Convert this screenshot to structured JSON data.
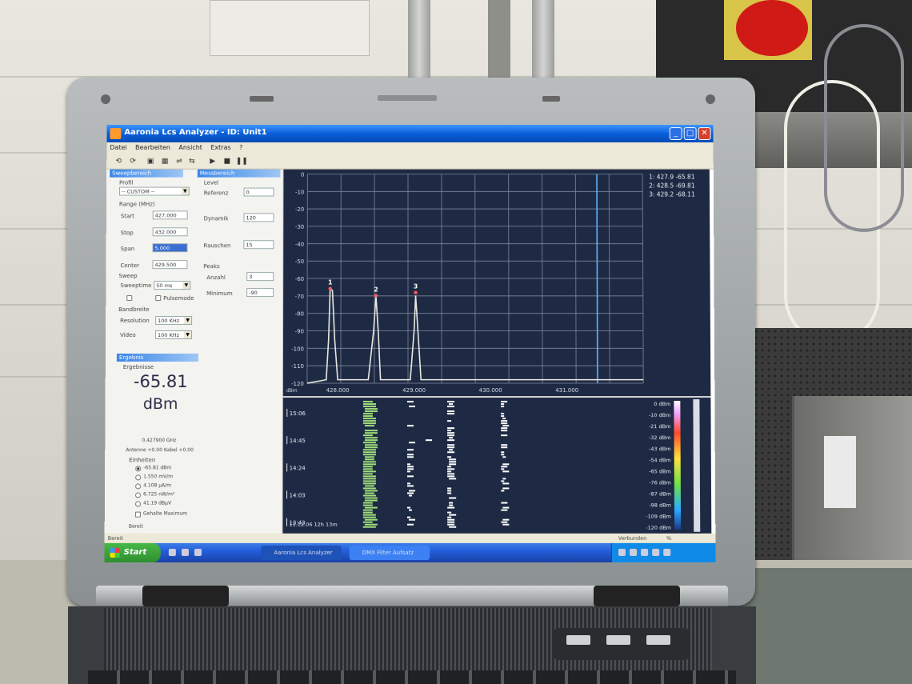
{
  "window": {
    "title": "Aaronia Lcs Analyzer - ID: Unit1",
    "controls": [
      "_",
      "□",
      "✕"
    ]
  },
  "menu": [
    "Datei",
    "Bearbeiten",
    "Ansicht",
    "Extras",
    "?"
  ],
  "toolbar": [
    "⟲",
    "⟳",
    "▣",
    "▦",
    "⇌",
    "⇆",
    "▶",
    "■",
    "❚❚"
  ],
  "sweep_panel": {
    "header": "Sweepbereich",
    "profil_label": "Profil",
    "profil_value": "-- CUSTOM --",
    "range_label": "Range (MHz)",
    "start_label": "Start",
    "start_value": "427.000",
    "stop_label": "Stop",
    "stop_value": "432.000",
    "span_label": "Span",
    "span_value": "5.000",
    "center_label": "Center",
    "center_value": "429.500",
    "sweep_label": "Sweep",
    "sweeptime_label": "Sweeptime",
    "sweeptime_value": "50 ms",
    "pulsemode_label": "Pulsemode",
    "bandwidth_label": "Bandbreite",
    "resolution_label": "Resolution",
    "resolution_value": "100 KHz",
    "video_label": "Video",
    "video_value": "100 KHz"
  },
  "level_panel": {
    "header": "Messbereich",
    "level_label": "Level",
    "referenz_label": "Referenz",
    "referenz_value": "0",
    "dynamik_label": "Dynamik",
    "dynamik_value": "120",
    "rauschen_label": "Rauschen",
    "rauschen_value": "15",
    "peaks_label": "Peaks",
    "anzahl_label": "Anzahl",
    "anzahl_value": "3",
    "minimum_label": "Minimum",
    "minimum_value": "-90"
  },
  "result_panel": {
    "header": "Ergebnis",
    "sub_label": "Ergebnisse",
    "big_value": "-65.81",
    "big_unit": "dBm",
    "freq_text": "0.427900 GHz",
    "antenna_text": "Antenne +0.00 Kabel +0.00",
    "units_label": "Einheiten",
    "units": [
      {
        "label": "-65.81 dBm",
        "checked": true
      },
      {
        "label": "1.550 mV/m",
        "checked": false
      },
      {
        "label": "4.108 µA/m",
        "checked": false
      },
      {
        "label": "6.725 nW/m²",
        "checked": false
      },
      {
        "label": "41.19 dBµV",
        "checked": false
      },
      {
        "label": "Gehalte Maximum",
        "checked": false
      }
    ],
    "footer": "Bereit"
  },
  "chart_data": {
    "type": "line",
    "title": "",
    "xlabel": "",
    "ylabel": "dBm",
    "x_ticks": [
      "428.000",
      "429.000",
      "430.000",
      "431.000"
    ],
    "y_ticks": [
      "0",
      "-10",
      "-20",
      "-30",
      "-40",
      "-50",
      "-60",
      "-70",
      "-80",
      "-90",
      "-100",
      "-110",
      "-120"
    ],
    "xlim": [
      427.6,
      432.0
    ],
    "ylim": [
      -120,
      0
    ],
    "grid": true,
    "series": [
      {
        "x": [
          427.6,
          427.85,
          427.88,
          427.9,
          427.93,
          427.96,
          428.0,
          428.4,
          428.47,
          428.5,
          428.53,
          428.56,
          428.95,
          429.0,
          429.02,
          429.05,
          429.09,
          432.0
        ],
        "y": [
          -120,
          -118,
          -95,
          -65.8,
          -67,
          -95,
          -118,
          -118,
          -90,
          -70,
          -90,
          -118,
          -118,
          -90,
          -69.8,
          -90,
          -118,
          -118
        ]
      }
    ],
    "markers": [
      {
        "label": "1",
        "x": 427.9,
        "y": -65.81
      },
      {
        "label": "2",
        "x": 428.5,
        "y": -69.81
      },
      {
        "label": "3",
        "x": 429.02,
        "y": -68.11
      }
    ],
    "marker_readout": [
      "1: 427.9 -65.81",
      "2: 428.5 -69.81",
      "3: 429.2 -68.11"
    ],
    "cursor_x": 431.4,
    "corner_label": "dBm"
  },
  "waterfall": {
    "time_labels": [
      "15:06",
      "14:45",
      "14:24",
      "14:03",
      "13:43"
    ],
    "date_label": "11.12.06 12h 13m",
    "scale_labels": [
      "0 dBm",
      "-10 dBm",
      "-21 dBm",
      "-32 dBm",
      "-43 dBm",
      "-54 dBm",
      "-65 dBm",
      "-76 dBm",
      "-87 dBm",
      "-98 dBm",
      "-109 dBm",
      "-120 dBm"
    ],
    "colors": {
      "hot": "#ffffff",
      "warm": "#9fe07a",
      "cool": "#2a3c66"
    }
  },
  "statusbar": {
    "left": "Bereit",
    "right": "Verbunden",
    "percent": "%"
  },
  "taskbar": {
    "start": "Start",
    "items": [
      "Aaronia Lcs Analyzer",
      "DMX Filter Aufsatz"
    ]
  },
  "accent_colors": {
    "titlebar": "#0a5fd8",
    "plot_bg": "#1e2a44",
    "trace": "#e8eadf",
    "cursor_line": "#5fb4ff",
    "peak_marker": "#ff5a5a"
  }
}
